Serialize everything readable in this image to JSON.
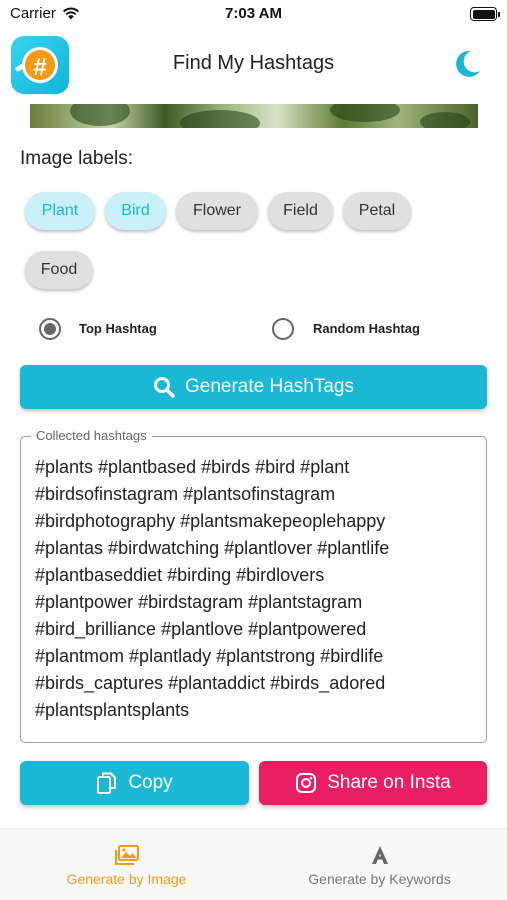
{
  "status_bar": {
    "carrier": "Carrier",
    "time": "7:03 AM"
  },
  "header": {
    "title": "Find My Hashtags",
    "logo_icon": "hashtag-logo-icon",
    "theme_icon": "moon-icon"
  },
  "labels": {
    "heading": "Image labels:",
    "chips": [
      {
        "label": "Plant",
        "selected": true
      },
      {
        "label": "Bird",
        "selected": true
      },
      {
        "label": "Flower",
        "selected": false
      },
      {
        "label": "Field",
        "selected": false
      },
      {
        "label": "Petal",
        "selected": false
      },
      {
        "label": "Food",
        "selected": false
      }
    ]
  },
  "mode": {
    "options": [
      {
        "label": "Top Hashtag",
        "selected": true
      },
      {
        "label": "Random Hashtag",
        "selected": false
      }
    ]
  },
  "generate_button": {
    "label": "Generate HashTags",
    "icon": "search-icon"
  },
  "hashtags": {
    "legend": "Collected hashtags",
    "lines": [
      "#plants #plantbased #birds #bird #plant",
      "#birdsofinstagram #plantsofinstagram",
      "#birdphotography #plantsmakepeoplehappy",
      "#plantas #birdwatching #plantlover #plantlife",
      "#plantbaseddiet #birding #birdlovers",
      "#plantpower #birdstagram #plantstagram",
      "#bird_brilliance #plantlove #plantpowered",
      "#plantmom #plantlady #plantstrong #birdlife",
      "#birds_captures #plantaddict #birds_adored",
      "#plantsplantsplants"
    ]
  },
  "actions": {
    "copy_label": "Copy",
    "copy_icon": "copy-icon",
    "share_label": "Share on Insta",
    "share_icon": "instagram-icon"
  },
  "bottom_nav": {
    "items": [
      {
        "label": "Generate by Image",
        "icon": "image-gallery-icon",
        "active": true
      },
      {
        "label": "Generate by Keywords",
        "icon": "font-letter-icon",
        "active": false
      }
    ]
  },
  "colors": {
    "accent": "#1ab8d4",
    "share": "#e91e63",
    "active_nav": "#f39a1d"
  }
}
